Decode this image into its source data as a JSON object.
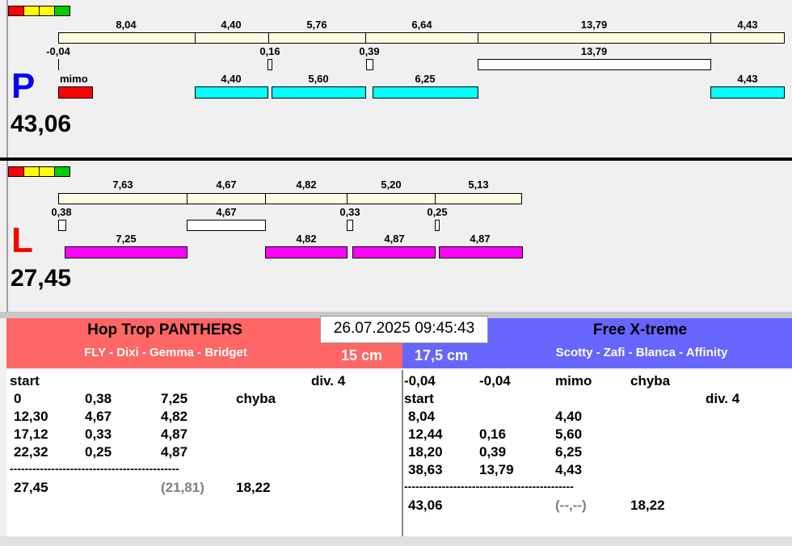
{
  "lane_p": {
    "letter": "P",
    "letter_color": "#0000ff",
    "total": "43,06",
    "lights": [
      "#ff0000",
      "#ffff00",
      "#ffff00",
      "#00cc00"
    ],
    "row1": [
      "8,04",
      "4,40",
      "5,76",
      "6,64",
      "13,79",
      "4,43"
    ],
    "row2": [
      "-0,04",
      "0,16",
      "0,39",
      "13,79"
    ],
    "row3_label": "mimo",
    "row3": [
      "4,40",
      "5,60",
      "6,25",
      "4,43"
    ]
  },
  "lane_l": {
    "letter": "L",
    "letter_color": "#ff0000",
    "total": "27,45",
    "lights": [
      "#ff0000",
      "#ffff00",
      "#ffff00",
      "#00cc00"
    ],
    "row1": [
      "7,63",
      "4,67",
      "4,82",
      "5,20",
      "5,13"
    ],
    "row2": [
      "0,38",
      "4,67",
      "0,33",
      "0,25"
    ],
    "row3": [
      "7,25",
      "4,82",
      "4,87",
      "4,87"
    ]
  },
  "datetime": "26.07.2025 09:45:43",
  "team_left": {
    "name": "Hop Trop PANTHERS",
    "members": "FLY - Dixi - Gemma - Bridget",
    "height": "15 cm",
    "color": "#ff6666"
  },
  "team_right": {
    "name": "Free X-treme",
    "members": "Scotty - Zafi - Blanca - Affinity",
    "height": "17,5 cm",
    "color": "#6666ff"
  },
  "left_table": {
    "header": [
      "start",
      "div. 4"
    ],
    "rows": [
      [
        "0",
        "0,38",
        "7,25",
        "chyba"
      ],
      [
        "12,30",
        "4,67",
        "4,82"
      ],
      [
        "17,12",
        "0,33",
        "4,87"
      ],
      [
        "22,32",
        "0,25",
        "4,87"
      ]
    ],
    "separator": "---------------------------------------------",
    "footer": [
      "27,45",
      "(21,81)",
      "18,22"
    ]
  },
  "right_table": {
    "row0": [
      "-0,04",
      "-0,04",
      "mimo",
      "chyba"
    ],
    "header": [
      "start",
      "div. 4"
    ],
    "rows": [
      [
        "8,04",
        "4,40"
      ],
      [
        "12,44",
        "0,16",
        "5,60"
      ],
      [
        "18,20",
        "0,39",
        "6,25"
      ],
      [
        "38,63",
        "13,79",
        "4,43"
      ]
    ],
    "separator": "---------------------------------------------",
    "footer": [
      "43,06",
      "(--,--)",
      "18,22"
    ]
  }
}
